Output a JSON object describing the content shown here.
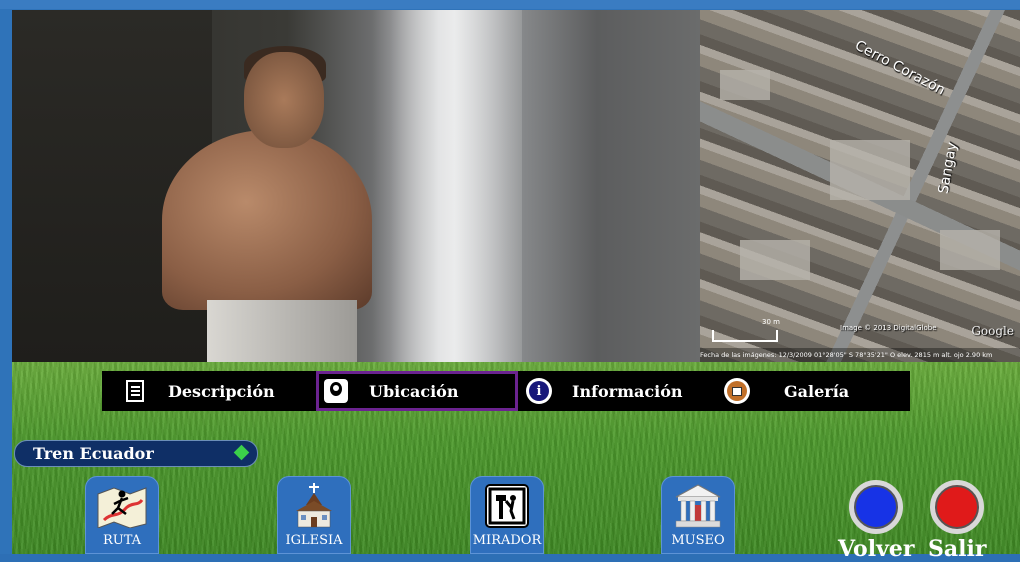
{
  "menu": {
    "items": [
      {
        "label": "Descripción",
        "icon": "document-icon"
      },
      {
        "label": "Ubicación",
        "icon": "location-pin-icon",
        "active": true
      },
      {
        "label": "Información",
        "icon": "info-icon"
      },
      {
        "label": "Galería",
        "icon": "gallery-icon"
      }
    ]
  },
  "section": {
    "title": "Tren Ecuador"
  },
  "nav": {
    "ruta": "RUTA",
    "iglesia": "IGLESIA",
    "mirador": "MIRADOR",
    "museo": "MUSEO"
  },
  "actions": {
    "volver": "Volver",
    "salir": "Salir"
  },
  "map": {
    "street1": "Cerro Corazón",
    "street2": "Sangay",
    "scale": "30 m",
    "credit": "Image © 2013 DigitalGlobe",
    "brand": "Google",
    "footer": "Fecha de las imágenes: 12/3/2009      01°28'05\" S 78°35'21\" O elev. 2815 m     alt. ojo 2.90 km"
  },
  "colors": {
    "accent_active": "#6b2390",
    "volver": "#1733e6",
    "salir": "#e01a1a",
    "nav_button": "#2f6fbd",
    "menubar": "#000000"
  }
}
